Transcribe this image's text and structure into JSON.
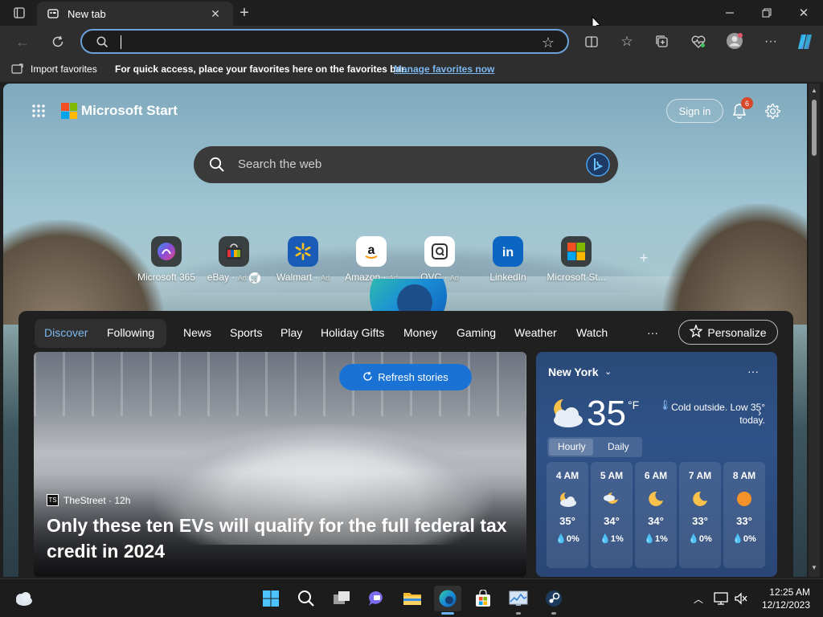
{
  "browser": {
    "tab_title": "New tab",
    "favorites_bar": {
      "import_label": "Import favorites",
      "hint_text": "For quick access, place your favorites here on the favorites bar.",
      "manage_link": "Manage favorites now"
    }
  },
  "start": {
    "brand": "Microsoft Start",
    "sign_in": "Sign in",
    "notification_count": "6",
    "search_placeholder": "Search the web",
    "quick_links": [
      {
        "label": "Microsoft 365",
        "ad": ""
      },
      {
        "label": "eBay",
        "ad": "Ad"
      },
      {
        "label": "Walmart",
        "ad": "Ad"
      },
      {
        "label": "Amazon",
        "ad": "Ad"
      },
      {
        "label": "QVC",
        "ad": "Ad"
      },
      {
        "label": "LinkedIn",
        "ad": ""
      },
      {
        "label": "Microsoft St...",
        "ad": ""
      }
    ]
  },
  "feed": {
    "tabs": [
      "Discover",
      "Following",
      "News",
      "Sports",
      "Play",
      "Holiday Gifts",
      "Money",
      "Gaming",
      "Weather",
      "Watch"
    ],
    "more": "···",
    "personalize": "Personalize",
    "refresh": "Refresh stories",
    "story": {
      "source_logo": "TS",
      "source": "TheStreet · 12h",
      "headline": "Only these ten EVs will qualify for the full federal tax credit in 2024"
    }
  },
  "weather": {
    "city": "New York",
    "temp": "35",
    "unit": "°F",
    "description": "Cold outside. Low 35° today.",
    "tabs": [
      "Hourly",
      "Daily"
    ],
    "hours": [
      {
        "time": "4 AM",
        "temp": "35°",
        "precip": "0%",
        "icon": "partly-cloudy-night-icon"
      },
      {
        "time": "5 AM",
        "temp": "34°",
        "precip": "1%",
        "icon": "partly-cloudy-night-icon"
      },
      {
        "time": "6 AM",
        "temp": "34°",
        "precip": "1%",
        "icon": "moon-icon"
      },
      {
        "time": "7 AM",
        "temp": "33°",
        "precip": "0%",
        "icon": "moon-icon"
      },
      {
        "time": "8 AM",
        "temp": "33°",
        "precip": "0%",
        "icon": "sun-icon"
      }
    ]
  },
  "taskbar": {
    "time": "12:25 AM",
    "date": "12/12/2023"
  },
  "colors": {
    "accent": "#1a73d4",
    "badge": "#d9472b",
    "weather_bg": "#2f5288"
  }
}
